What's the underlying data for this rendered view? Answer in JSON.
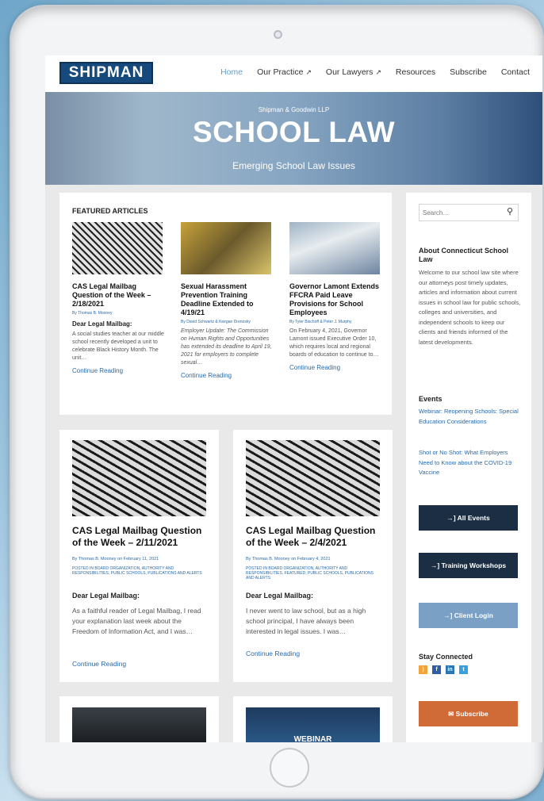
{
  "nav": {
    "logo": "SHIPMAN",
    "links": [
      "Home",
      "Our Practice",
      "Our Lawyers",
      "Resources",
      "Subscribe",
      "Contact"
    ],
    "ext_icon": "↗"
  },
  "hero": {
    "firm": "Shipman & Goodwin LLP",
    "title": "SCHOOL LAW",
    "tagline": "Emerging School Law Issues"
  },
  "featured": {
    "heading": "FEATURED ARTICLES",
    "articles": [
      {
        "title": "CAS Legal Mailbag Question of the Week – 2/18/2021",
        "byline": "By Thomas B. Mooney",
        "subhead": "Dear Legal Mailbag:",
        "excerpt": "A social studies teacher at our middle school recently developed a unit to celebrate Black History Month. The unit…",
        "more": "Continue Reading"
      },
      {
        "title": "Sexual Harassment Prevention Training Deadline Extended to 4/19/21",
        "byline": "By David Schwartz & Keegan Drenosky",
        "subhead": "Employer Update: The Commission on Human Rights and Opportunities has extended its deadline to April 19, 2021 for employers to complete sexual…",
        "excerpt": "",
        "more": "Continue Reading"
      },
      {
        "title": "Governor Lamont Extends FFCRA Paid Leave Provisions for School Employees",
        "byline": "By Tyler Bischoff & Peter J. Murphy",
        "subhead": "",
        "excerpt": "On February 4, 2021, Governor Lamont issued Executive Order 10, which requires local and regional boards of education to continue to…",
        "more": "Continue Reading"
      }
    ]
  },
  "cards": [
    {
      "title": "CAS Legal Mailbag Question of the Week – 2/11/2021",
      "byline": "By Thomas B. Mooney on February 11, 2021",
      "posted": "POSTED IN BOARD ORGANIZATION, AUTHORITY AND RESPONSIBILITIES, PUBLIC SCHOOLS, PUBLICATIONS AND ALERTS",
      "subhead": "Dear Legal Mailbag:",
      "excerpt": "As a faithful reader of Legal Mailbag, I read your explanation last week about the Freedom of Information Act, and I was…",
      "more": "Continue Reading"
    },
    {
      "title": "CAS Legal Mailbag Question of the Week – 2/4/2021",
      "byline": "By Thomas B. Mooney on February 4, 2021",
      "posted": "POSTED IN BOARD ORGANIZATION, AUTHORITY AND RESPONSIBILITIES, FEATURED, PUBLIC SCHOOLS, PUBLICATIONS AND ALERTS",
      "subhead": "Dear Legal Mailbag:",
      "excerpt": "I never went to law school, but as a high school principal, I have always been interested in legal issues. I was…",
      "more": "Continue Reading"
    }
  ],
  "bottom_cards": [
    {
      "label": ""
    },
    {
      "label": "WEBINAR"
    }
  ],
  "sidebar": {
    "search_placeholder": "Search…",
    "about_title": "About Connecticut School Law",
    "about_text": "Welcome to our school law site where our attorneys post timely updates, articles and information about current issues in school law for public schools, colleges and universities, and independent schools to keep our clients and friends informed of the latest developments.",
    "events_title": "Events",
    "events": [
      "Webinar: Reopening Schools: Special Education Considerations",
      "Shot or No Shot: What Employers Need to Know about the COVID-19 Vaccine"
    ],
    "btn_all_events": "→] All Events",
    "btn_training": "→] Training Workshops",
    "btn_client": "→] Client Login",
    "stay_title": "Stay Connected",
    "btn_subscribe": "✉ Subscribe"
  },
  "colors": {
    "brand_navy": "#174a7c",
    "button_navy": "#1c2e44",
    "link_blue": "#2a6aa8",
    "subscribe_orange": "#d06b37"
  }
}
